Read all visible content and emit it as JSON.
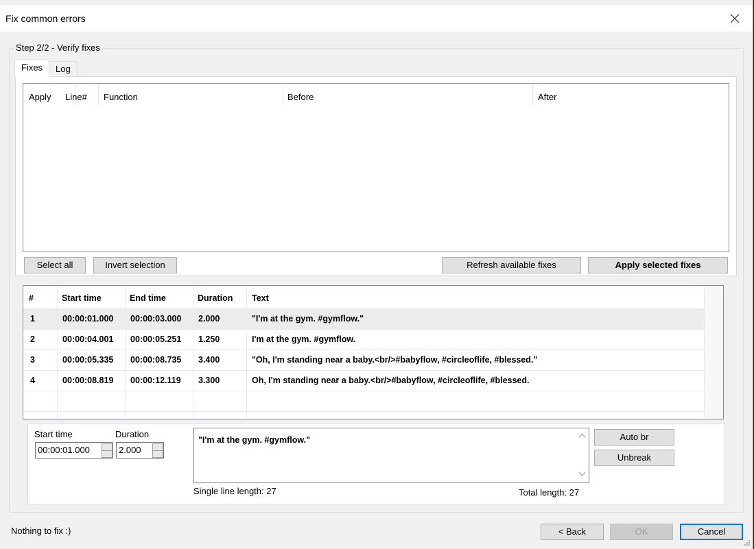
{
  "window": {
    "title": "Fix common errors"
  },
  "group": {
    "legend": "Step 2/2 - Verify fixes"
  },
  "tabs": [
    {
      "label": "Fixes"
    },
    {
      "label": "Log"
    }
  ],
  "fixes_list": {
    "columns": [
      "Apply",
      "Line#",
      "Function",
      "Before",
      "After"
    ]
  },
  "buttons": {
    "select_all": "Select all",
    "invert_selection": "Invert selection",
    "refresh": "Refresh available fixes",
    "apply_selected": "Apply selected fixes",
    "auto_br": "Auto br",
    "unbreak": "Unbreak",
    "back": "< Back",
    "ok": "OK",
    "cancel": "Cancel"
  },
  "subtitles": {
    "columns": [
      "#",
      "Start time",
      "End time",
      "Duration",
      "Text"
    ],
    "rows": [
      {
        "num": "1",
        "start": "00:00:01.000",
        "end": "00:00:03.000",
        "duration": "2.000",
        "text": "\"I'm at the gym. #gymflow.\""
      },
      {
        "num": "2",
        "start": "00:00:04.001",
        "end": "00:00:05.251",
        "duration": "1.250",
        "text": "I'm at the gym. #gymflow."
      },
      {
        "num": "3",
        "start": "00:00:05.335",
        "end": "00:00:08.735",
        "duration": "3.400",
        "text": "\"Oh, I'm standing near a baby.<br/>#babyflow, #circleoflife, #blessed.\""
      },
      {
        "num": "4",
        "start": "00:00:08.819",
        "end": "00:00:12.119",
        "duration": "3.300",
        "text": "Oh, I'm standing near a baby.<br/>#babyflow, #circleoflife, #blessed."
      }
    ]
  },
  "editor": {
    "start_time_label": "Start time",
    "start_time_value": "00:00:01.000",
    "duration_label": "Duration",
    "duration_value": "2.000",
    "text": "\"I'm at the gym. #gymflow.\"",
    "single_line_length": "Single line length: 27",
    "total_length": "Total length: 27"
  },
  "status": "Nothing to fix :)",
  "colors": {
    "accent": "#0078d7",
    "selected_row": "#ececec"
  }
}
